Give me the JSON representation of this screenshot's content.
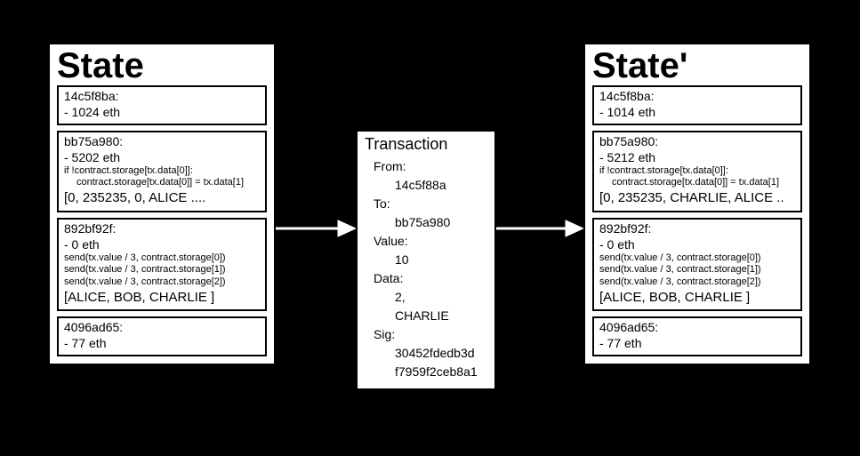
{
  "state": {
    "title": "State",
    "entries": [
      {
        "addr": "14c5f8ba:",
        "bal": "- 1024 eth"
      },
      {
        "addr": "bb75a980:",
        "bal": "- 5202 eth",
        "code1": "if !contract.storage[tx.data[0]]:",
        "code2": "contract.storage[tx.data[0]] = tx.data[1]",
        "storage": "[0, 235235, 0, ALICE ...."
      },
      {
        "addr": "892bf92f:",
        "bal": "- 0 eth",
        "c1": "send(tx.value / 3, contract.storage[0])",
        "c2": "send(tx.value / 3, contract.storage[1])",
        "c3": "send(tx.value / 3, contract.storage[2])",
        "storage": "[ALICE, BOB, CHARLIE ]"
      },
      {
        "addr": "4096ad65:",
        "bal": "- 77 eth"
      }
    ]
  },
  "tx": {
    "title": "Transaction",
    "from_l": "From:",
    "from": "14c5f88a",
    "to_l": "To:",
    "to": "bb75a980",
    "val_l": "Value:",
    "val": "10",
    "data_l": "Data:",
    "data1": "2,",
    "data2": "CHARLIE",
    "sig_l": "Sig:",
    "sig1": "30452fdedb3d",
    "sig2": "f7959f2ceb8a1"
  },
  "state2": {
    "title": "State'",
    "entries": [
      {
        "addr": "14c5f8ba:",
        "bal": "- 1014 eth"
      },
      {
        "addr": "bb75a980:",
        "bal": "- 5212 eth",
        "code1": "if !contract.storage[tx.data[0]]:",
        "code2": "contract.storage[tx.data[0]] = tx.data[1]",
        "storage": "[0, 235235, CHARLIE, ALICE .."
      },
      {
        "addr": "892bf92f:",
        "bal": "- 0 eth",
        "c1": "send(tx.value / 3, contract.storage[0])",
        "c2": "send(tx.value / 3, contract.storage[1])",
        "c3": "send(tx.value / 3, contract.storage[2])",
        "storage": "[ALICE, BOB, CHARLIE ]"
      },
      {
        "addr": "4096ad65:",
        "bal": "- 77 eth"
      }
    ]
  }
}
